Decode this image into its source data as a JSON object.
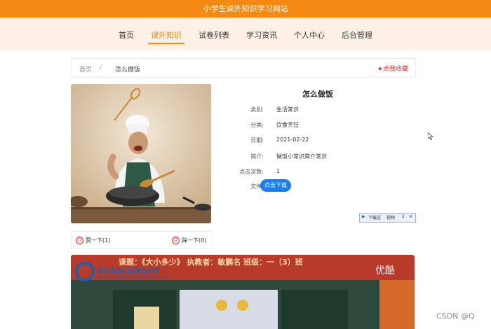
{
  "header": {
    "site_title": "小学生课外知识学习网站"
  },
  "nav": {
    "items": [
      "首页",
      "课外知识",
      "试卷列表",
      "学习资讯",
      "个人中心",
      "后台管理"
    ],
    "active_index": 1
  },
  "breadcrumb": {
    "home": "首页",
    "separator": "/",
    "current": "怎么做饭",
    "favorite_label": "点我收藏"
  },
  "detail": {
    "title": "怎么做饭",
    "fields": [
      {
        "key": "类别:",
        "value": "生活常识"
      },
      {
        "key": "分类:",
        "value": "饮食烹饪"
      },
      {
        "key": "日期:",
        "value": "2021-02-22"
      },
      {
        "key": "简介:",
        "value": "做饭小常识简介常识"
      },
      {
        "key": "点击次数:",
        "value": "1"
      },
      {
        "key": "文件:",
        "value": ""
      }
    ],
    "download_label": "点击下载"
  },
  "popup": {
    "label1": "下载这",
    "label2": "视频",
    "count": "2"
  },
  "votes": {
    "like_label": "赞一下(1)",
    "dislike_label": "踩一下(0)"
  },
  "video": {
    "caption": "课题：《大小多少》 执教者：敏鹏名 班级：一（3）班",
    "school_name": "深圳市南山区珠光小学",
    "school_en": "SHENZHEN NANSHAN ZHUGUANG PRIMARY SCHOOL",
    "brand": "优酷"
  },
  "watermark": "CSDN @Q",
  "colors": {
    "accent": "#f48a12",
    "nav_bg": "#fdf1e7",
    "link_red": "#d9342b",
    "button_blue": "#1a7df0"
  }
}
